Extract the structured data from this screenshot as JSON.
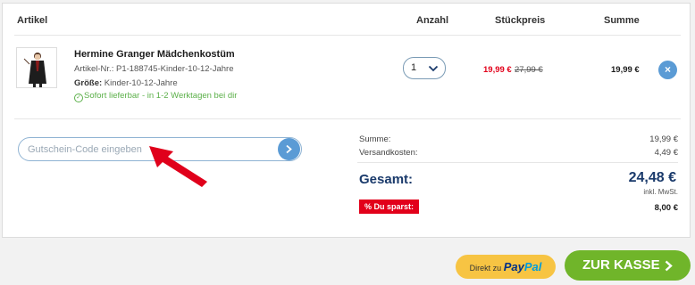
{
  "table": {
    "col_article": "Artikel",
    "col_qty": "Anzahl",
    "col_unit_price": "Stückpreis",
    "col_total": "Summe"
  },
  "item": {
    "name": "Hermine Granger Mädchenkostüm",
    "article_no_label": "Artikel-Nr.:",
    "article_no": "P1-188745-Kinder-10-12-Jahre",
    "size_label": "Größe:",
    "size": "Kinder-10-12-Jahre",
    "availability": "Sofort lieferbar - in 1-2 Werktagen bei dir",
    "quantity": "1",
    "price": "19,99 €",
    "old_price": "27,99 €",
    "sum": "19,99 €",
    "remove": "×"
  },
  "coupon": {
    "placeholder": "Gutschein-Code eingeben"
  },
  "totals": {
    "subtotal_label": "Summe:",
    "subtotal": "19,99 €",
    "shipping_label": "Versandkosten:",
    "shipping": "4,49 €",
    "grand_label": "Gesamt:",
    "grand": "24,48 €",
    "vat_note": "inkl. MwSt.",
    "savings_label": "% Du sparst:",
    "savings": "8,00 €"
  },
  "actions": {
    "paypal_prefix": "Direkt zu",
    "paypal_brand_a": "Pay",
    "paypal_brand_b": "Pal",
    "checkout": "ZUR KASSE"
  },
  "colors": {
    "accent_blue": "#5b9bd5",
    "checkout_green": "#70b52a",
    "paypal_yellow": "#f7c443",
    "sale_red": "#e2001a",
    "annotation_arrow": "#e0001b"
  }
}
